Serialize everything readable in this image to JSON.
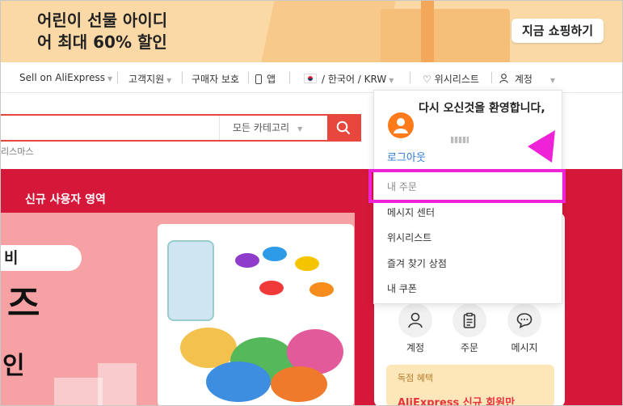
{
  "promo": {
    "line1": "어린이 선물 아이디",
    "line2": "어 최대 60% 할인",
    "cta": "지금 쇼핑하기"
  },
  "topnav": {
    "sell": "Sell on AliExpress",
    "support": "고객지원",
    "protection": "구매자 보호",
    "app": "앱",
    "locale": "/ 한국어 / KRW",
    "wishlist": "위시리스트",
    "account": "계정"
  },
  "search": {
    "category": "모든 카테고리",
    "hint": "리스마스"
  },
  "section": {
    "title": "신규 사용자 영역",
    "pill": "비",
    "big1": "즈",
    "big2": "인"
  },
  "account_panel": {
    "icons": [
      {
        "icon": "person-icon",
        "label": "계정"
      },
      {
        "icon": "clipboard-icon",
        "label": "주문"
      },
      {
        "icon": "chat-icon",
        "label": "메시지"
      }
    ],
    "benefit_label": "독점 혜택",
    "benefit_title": "AliExpress 신규 회원만"
  },
  "dropdown": {
    "welcome": "다시 오신것을 환영합니다,",
    "logout": "로그아웃",
    "items": [
      "내 주문",
      "메시지 센터",
      "위시리스트",
      "즐겨 찾기 상점",
      "내 쿠폰"
    ]
  },
  "colors": {
    "accent_red": "#e8473d",
    "section_red": "#d5183a",
    "highlight_magenta": "#ee22d6",
    "link_blue": "#2b7bd1"
  }
}
